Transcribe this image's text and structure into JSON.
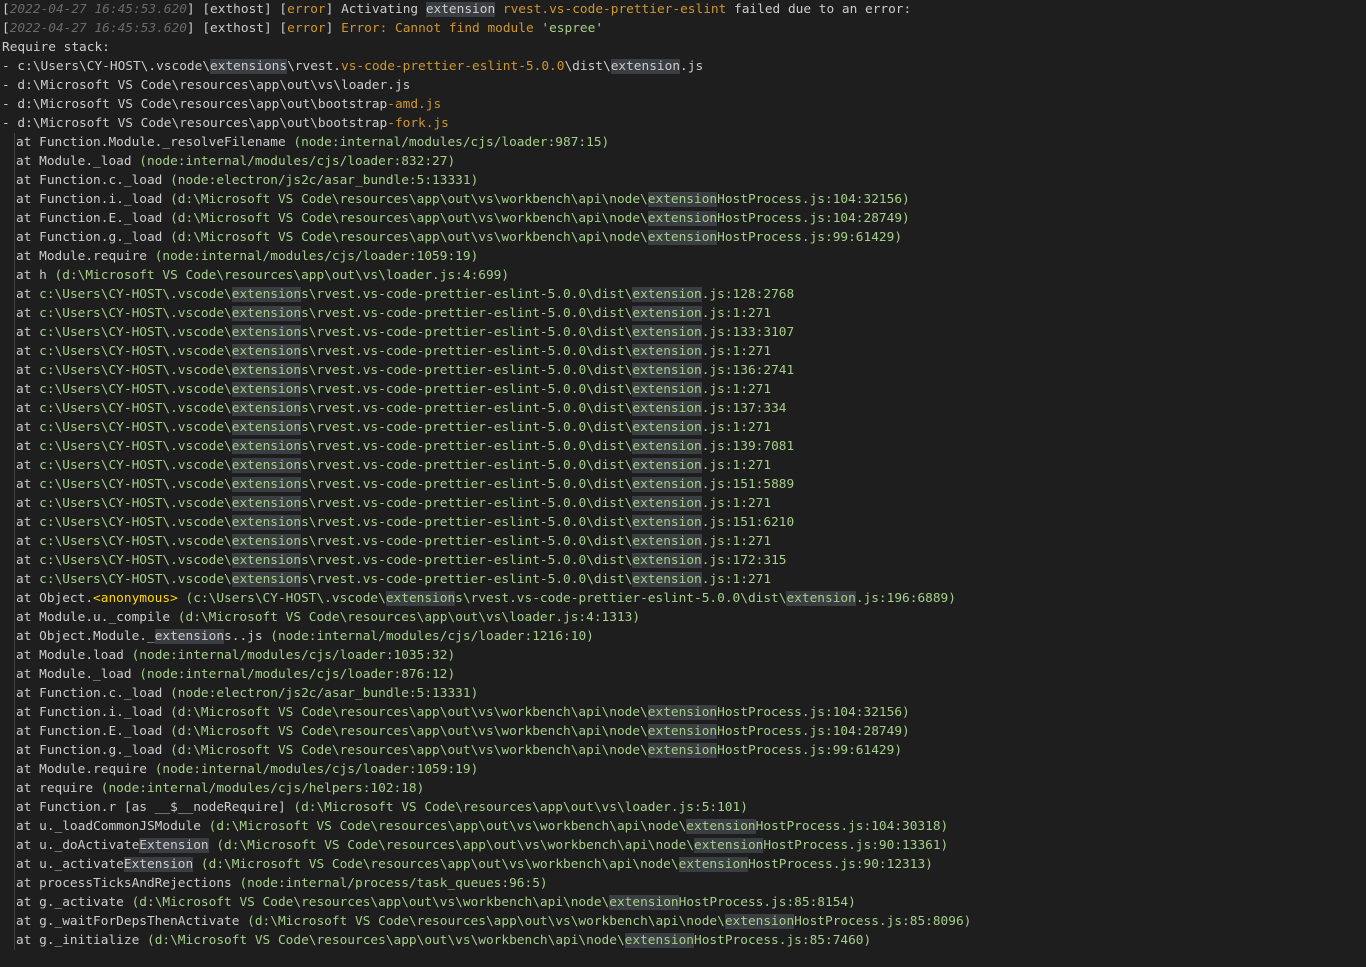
{
  "header_lines": [
    {
      "ts": "2022-04-27 16:45:53.620",
      "proc": "exthost",
      "level": "error",
      "pre": "Activating ",
      "hl": "extension",
      "mid": " ",
      "ext": "rvest.vs-code-prettier-eslint",
      "post": " failed due to an error:"
    },
    {
      "ts": "2022-04-27 16:45:53.620",
      "proc": "exthost",
      "level": "error",
      "pre": "Error: Cannot find module ",
      "str": "'espree'"
    }
  ],
  "require_stack_label": "Require stack:",
  "require_stack": [
    {
      "a": "- c:\\Users\\CY-HOST\\.vscode\\",
      "hl": "extensions",
      "b": "\\rvest.",
      "c": "vs-code-prettier-eslint-5.0.0",
      "d": "\\dist\\",
      "hl2": "extension",
      "e": ".js"
    },
    {
      "a": "- d:\\Microsoft VS Code\\resources\\app\\out\\vs\\loader.js"
    },
    {
      "a": "- d:\\Microsoft VS Code\\resources\\app\\out\\bootstrap",
      "c": "-amd.js"
    },
    {
      "a": "- d:\\Microsoft VS Code\\resources\\app\\out\\bootstrap",
      "c": "-fork.js"
    }
  ],
  "stack_frames": [
    "at Function.Module._resolveFilename (node:internal/modules/cjs/loader:987:15)",
    "at Module._load (node:internal/modules/cjs/loader:832:27)",
    "at Function.c._load (node:electron/js2c/asar_bundle:5:13331)",
    "at Function.i._load (d:\\Microsoft VS Code\\resources\\app\\out\\vs\\workbench\\api\\node\\extensionHostProcess.js:104:32156)",
    "at Function.E._load (d:\\Microsoft VS Code\\resources\\app\\out\\vs\\workbench\\api\\node\\extensionHostProcess.js:104:28749)",
    "at Function.g._load (d:\\Microsoft VS Code\\resources\\app\\out\\vs\\workbench\\api\\node\\extensionHostProcess.js:99:61429)",
    "at Module.require (node:internal/modules/cjs/loader:1059:19)",
    "at h (d:\\Microsoft VS Code\\resources\\app\\out\\vs\\loader.js:4:699)",
    "at c:\\Users\\CY-HOST\\.vscode\\extensions\\rvest.vs-code-prettier-eslint-5.0.0\\dist\\extension.js:128:2768",
    "at c:\\Users\\CY-HOST\\.vscode\\extensions\\rvest.vs-code-prettier-eslint-5.0.0\\dist\\extension.js:1:271",
    "at c:\\Users\\CY-HOST\\.vscode\\extensions\\rvest.vs-code-prettier-eslint-5.0.0\\dist\\extension.js:133:3107",
    "at c:\\Users\\CY-HOST\\.vscode\\extensions\\rvest.vs-code-prettier-eslint-5.0.0\\dist\\extension.js:1:271",
    "at c:\\Users\\CY-HOST\\.vscode\\extensions\\rvest.vs-code-prettier-eslint-5.0.0\\dist\\extension.js:136:2741",
    "at c:\\Users\\CY-HOST\\.vscode\\extensions\\rvest.vs-code-prettier-eslint-5.0.0\\dist\\extension.js:1:271",
    "at c:\\Users\\CY-HOST\\.vscode\\extensions\\rvest.vs-code-prettier-eslint-5.0.0\\dist\\extension.js:137:334",
    "at c:\\Users\\CY-HOST\\.vscode\\extensions\\rvest.vs-code-prettier-eslint-5.0.0\\dist\\extension.js:1:271",
    "at c:\\Users\\CY-HOST\\.vscode\\extensions\\rvest.vs-code-prettier-eslint-5.0.0\\dist\\extension.js:139:7081",
    "at c:\\Users\\CY-HOST\\.vscode\\extensions\\rvest.vs-code-prettier-eslint-5.0.0\\dist\\extension.js:1:271",
    "at c:\\Users\\CY-HOST\\.vscode\\extensions\\rvest.vs-code-prettier-eslint-5.0.0\\dist\\extension.js:151:5889",
    "at c:\\Users\\CY-HOST\\.vscode\\extensions\\rvest.vs-code-prettier-eslint-5.0.0\\dist\\extension.js:1:271",
    "at c:\\Users\\CY-HOST\\.vscode\\extensions\\rvest.vs-code-prettier-eslint-5.0.0\\dist\\extension.js:151:6210",
    "at c:\\Users\\CY-HOST\\.vscode\\extensions\\rvest.vs-code-prettier-eslint-5.0.0\\dist\\extension.js:1:271",
    "at c:\\Users\\CY-HOST\\.vscode\\extensions\\rvest.vs-code-prettier-eslint-5.0.0\\dist\\extension.js:172:315",
    "at c:\\Users\\CY-HOST\\.vscode\\extensions\\rvest.vs-code-prettier-eslint-5.0.0\\dist\\extension.js:1:271",
    "at Object.<anonymous> (c:\\Users\\CY-HOST\\.vscode\\extensions\\rvest.vs-code-prettier-eslint-5.0.0\\dist\\extension.js:196:6889)",
    "at Module.u._compile (d:\\Microsoft VS Code\\resources\\app\\out\\vs\\loader.js:4:1313)",
    "at Object.Module._extensions..js (node:internal/modules/cjs/loader:1216:10)",
    "at Module.load (node:internal/modules/cjs/loader:1035:32)",
    "at Module._load (node:internal/modules/cjs/loader:876:12)",
    "at Function.c._load (node:electron/js2c/asar_bundle:5:13331)",
    "at Function.i._load (d:\\Microsoft VS Code\\resources\\app\\out\\vs\\workbench\\api\\node\\extensionHostProcess.js:104:32156)",
    "at Function.E._load (d:\\Microsoft VS Code\\resources\\app\\out\\vs\\workbench\\api\\node\\extensionHostProcess.js:104:28749)",
    "at Function.g._load (d:\\Microsoft VS Code\\resources\\app\\out\\vs\\workbench\\api\\node\\extensionHostProcess.js:99:61429)",
    "at Module.require (node:internal/modules/cjs/loader:1059:19)",
    "at require (node:internal/modules/cjs/helpers:102:18)",
    "at Function.r [as __$__nodeRequire] (d:\\Microsoft VS Code\\resources\\app\\out\\vs\\loader.js:5:101)",
    "at u._loadCommonJSModule (d:\\Microsoft VS Code\\resources\\app\\out\\vs\\workbench\\api\\node\\extensionHostProcess.js:104:30318)",
    "at u._doActivateExtension (d:\\Microsoft VS Code\\resources\\app\\out\\vs\\workbench\\api\\node\\extensionHostProcess.js:90:13361)",
    "at u._activateExtension (d:\\Microsoft VS Code\\resources\\app\\out\\vs\\workbench\\api\\node\\extensionHostProcess.js:90:12313)",
    "at processTicksAndRejections (node:internal/process/task_queues:96:5)",
    "at g._activate (d:\\Microsoft VS Code\\resources\\app\\out\\vs\\workbench\\api\\node\\extensionHostProcess.js:85:8154)",
    "at g._waitForDepsThenActivate (d:\\Microsoft VS Code\\resources\\app\\out\\vs\\workbench\\api\\node\\extensionHostProcess.js:85:8096)",
    "at g._initialize (d:\\Microsoft VS Code\\resources\\app\\out\\vs\\workbench\\api\\node\\extensionHostProcess.js:85:7460)"
  ],
  "highlight_word": "extension",
  "colors": {
    "background": "#1e1e1e",
    "text": "#cccccc",
    "timestamp": "#6a6a6a",
    "level": "#cd9731",
    "string": "#ce9178",
    "location": "#a5cf8a",
    "anonymous": "#ffd700",
    "highlight": "#3a3d41"
  }
}
